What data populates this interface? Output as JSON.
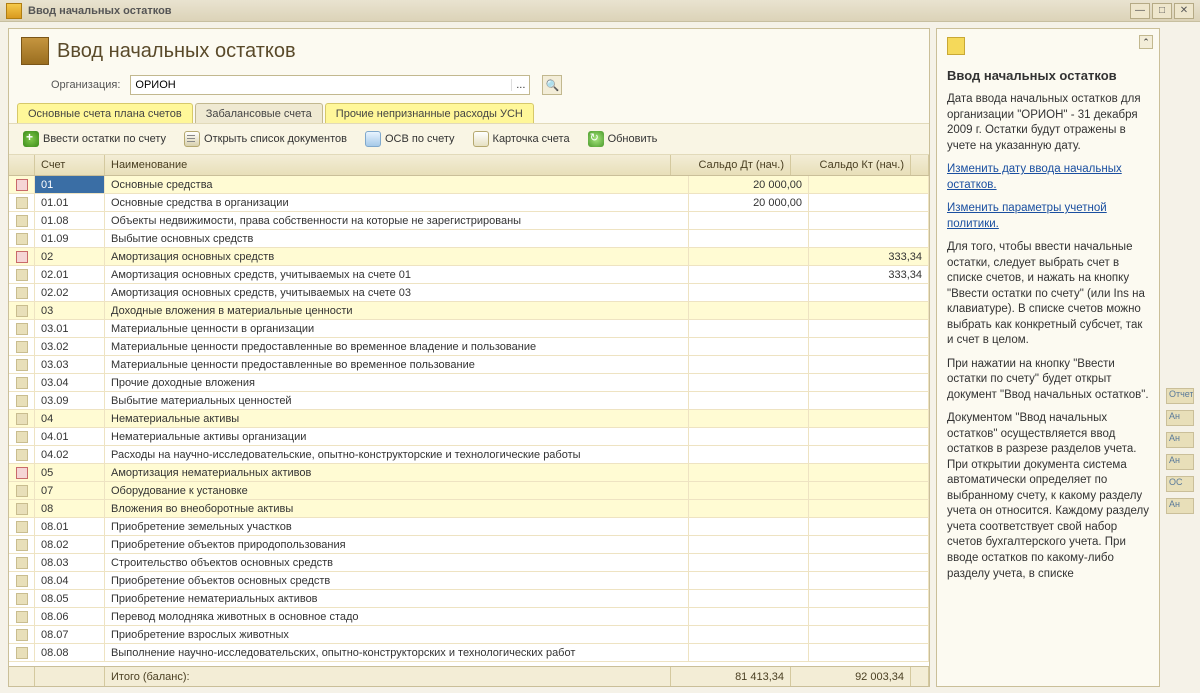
{
  "window": {
    "title": "Ввод начальных остатков"
  },
  "header": {
    "title": "Ввод начальных остатков",
    "org_label": "Организация:",
    "org_value": "ОРИОН"
  },
  "tabs": [
    {
      "label": "Основные счета плана счетов",
      "active": true
    },
    {
      "label": "Забалансовые счета",
      "active": false
    },
    {
      "label": "Прочие непризнанные расходы УСН",
      "active": false,
      "highlight": true
    }
  ],
  "toolbar": {
    "add": "Ввести остатки по счету",
    "open_docs": "Открыть список документов",
    "osv": "ОСВ по счету",
    "card": "Карточка счета",
    "refresh": "Обновить"
  },
  "grid": {
    "headers": {
      "acc": "Счет",
      "name": "Наименование",
      "dt": "Сальдо Дт (нач.)",
      "kt": "Сальдо Кт (нач.)"
    },
    "rows": [
      {
        "acc": "01",
        "name": "Основные средства",
        "dt": "20 000,00",
        "kt": "",
        "yel": true,
        "red": true,
        "sel": true
      },
      {
        "acc": "01.01",
        "name": "Основные средства в организации",
        "dt": "20 000,00",
        "kt": ""
      },
      {
        "acc": "01.08",
        "name": "Объекты недвижимости, права собственности на которые не зарегистрированы",
        "dt": "",
        "kt": ""
      },
      {
        "acc": "01.09",
        "name": "Выбытие основных средств",
        "dt": "",
        "kt": ""
      },
      {
        "acc": "02",
        "name": "Амортизация основных средств",
        "dt": "",
        "kt": "333,34",
        "yel": true,
        "red": true
      },
      {
        "acc": "02.01",
        "name": "Амортизация основных средств, учитываемых на счете 01",
        "dt": "",
        "kt": "333,34"
      },
      {
        "acc": "02.02",
        "name": "Амортизация основных средств, учитываемых на счете 03",
        "dt": "",
        "kt": ""
      },
      {
        "acc": "03",
        "name": "Доходные вложения в материальные ценности",
        "dt": "",
        "kt": "",
        "yel": true
      },
      {
        "acc": "03.01",
        "name": "Материальные ценности в организации",
        "dt": "",
        "kt": ""
      },
      {
        "acc": "03.02",
        "name": "Материальные ценности предоставленные во временное владение и пользование",
        "dt": "",
        "kt": ""
      },
      {
        "acc": "03.03",
        "name": "Материальные ценности предоставленные во временное пользование",
        "dt": "",
        "kt": ""
      },
      {
        "acc": "03.04",
        "name": "Прочие доходные вложения",
        "dt": "",
        "kt": ""
      },
      {
        "acc": "03.09",
        "name": "Выбытие материальных ценностей",
        "dt": "",
        "kt": ""
      },
      {
        "acc": "04",
        "name": "Нематериальные активы",
        "dt": "",
        "kt": "",
        "yel": true
      },
      {
        "acc": "04.01",
        "name": "Нематериальные активы организации",
        "dt": "",
        "kt": ""
      },
      {
        "acc": "04.02",
        "name": "Расходы на научно-исследовательские, опытно-конструкторские и технологические работы",
        "dt": "",
        "kt": ""
      },
      {
        "acc": "05",
        "name": "Амортизация нематериальных активов",
        "dt": "",
        "kt": "",
        "yel": true,
        "red": true
      },
      {
        "acc": "07",
        "name": "Оборудование к установке",
        "dt": "",
        "kt": "",
        "yel": true
      },
      {
        "acc": "08",
        "name": "Вложения во внеоборотные активы",
        "dt": "",
        "kt": "",
        "yel": true
      },
      {
        "acc": "08.01",
        "name": "Приобретение земельных участков",
        "dt": "",
        "kt": ""
      },
      {
        "acc": "08.02",
        "name": "Приобретение объектов природопользования",
        "dt": "",
        "kt": ""
      },
      {
        "acc": "08.03",
        "name": "Строительство объектов основных средств",
        "dt": "",
        "kt": ""
      },
      {
        "acc": "08.04",
        "name": "Приобретение объектов основных средств",
        "dt": "",
        "kt": ""
      },
      {
        "acc": "08.05",
        "name": "Приобретение нематериальных активов",
        "dt": "",
        "kt": ""
      },
      {
        "acc": "08.06",
        "name": "Перевод молодняка животных в основное стадо",
        "dt": "",
        "kt": ""
      },
      {
        "acc": "08.07",
        "name": "Приобретение взрослых животных",
        "dt": "",
        "kt": ""
      },
      {
        "acc": "08.08",
        "name": "Выполнение научно-исследовательских, опытно-конструкторских и технологических работ",
        "dt": "",
        "kt": ""
      }
    ],
    "footer": {
      "label": "Итого (баланс):",
      "dt": "81 413,34",
      "kt": "92 003,34"
    }
  },
  "help": {
    "title": "Ввод начальных остатков",
    "p1": "Дата ввода начальных остатков для организации \"ОРИОН\" - 31 декабря 2009 г. Остатки будут отражены в учете на указанную дату.",
    "link1": "Изменить дату ввода начальных остатков.",
    "link2": "Изменить параметры учетной политики.",
    "p2": "Для того, чтобы ввести начальные остатки, следует выбрать счет в списке счетов, и нажать на кнопку \"Ввести остатки по счету\" (или Ins на клавиатуре). В списке счетов можно выбрать как конкретный субсчет, так и счет в целом.",
    "p3": "При нажатии на кнопку \"Ввести остатки по счету\" будет открыт документ \"Ввод начальных остатков\".",
    "p4": "Документом \"Ввод начальных остатков\" осуществляется ввод остатков в разрезе разделов учета. При открытии документа система автоматически определяет по выбранному счету, к какому разделу учета он относится. Каждому разделу учета соответствует свой набор счетов бухгалтерского учета. При вводе остатков по какому-либо разделу учета, в списке"
  },
  "sliver": [
    "Отчеты",
    "Ан",
    "Ан",
    "Ан",
    "ОС",
    "Ан"
  ]
}
